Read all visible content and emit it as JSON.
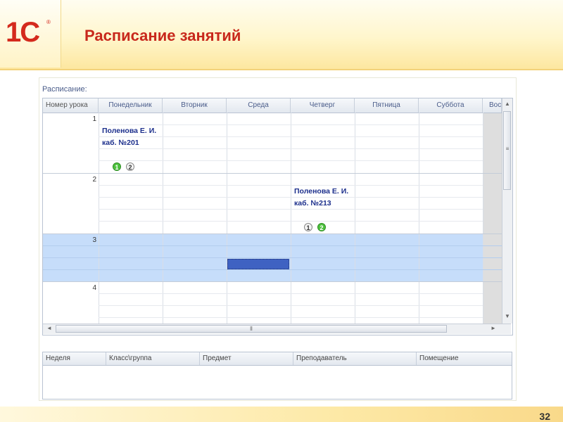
{
  "header": {
    "logo_text": "1С",
    "logo_reg": "®",
    "title": "Расписание занятий"
  },
  "schedule": {
    "label": "Расписание:",
    "columns": [
      "Номер урока",
      "Понедельник",
      "Вторник",
      "Среда",
      "Четверг",
      "Пятница",
      "Суббота",
      "Вос"
    ],
    "rows": [
      {
        "number": "1"
      },
      {
        "number": "2"
      },
      {
        "number": "3"
      },
      {
        "number": "4"
      }
    ],
    "entries": [
      {
        "teacher": "Поленова Е. И.",
        "room": "каб. №201",
        "badges": [
          "1",
          "2"
        ],
        "active_badge": "1"
      },
      {
        "teacher": "Поленова Е. И.",
        "room": "каб. №213",
        "badges": [
          "1",
          "2"
        ],
        "active_badge": "2"
      }
    ],
    "scroll": {
      "up": "▲",
      "down": "▼",
      "left": "◄",
      "right": "►",
      "grip_v": "≡",
      "grip_h": "⦀"
    }
  },
  "details": {
    "columns": [
      "Неделя",
      "Класс\\группа",
      "Предмет",
      "Преподаватель",
      "Помещение"
    ]
  },
  "colors": {
    "title": "#c8281c",
    "teacher": "#1c2f8c",
    "selected_row": "#c6ddfa",
    "selected_cell": "#3f62c2",
    "badge_active": "#4fc23f"
  },
  "page_number": "32"
}
